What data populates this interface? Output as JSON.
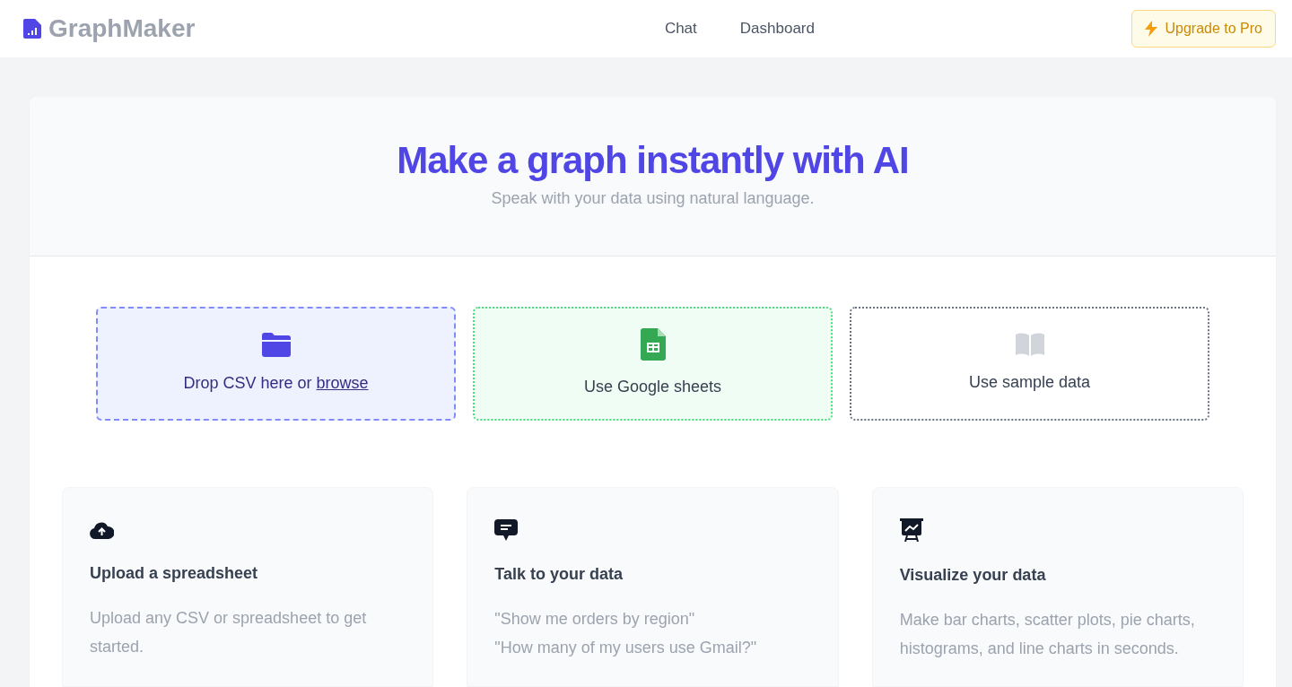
{
  "brand": {
    "name": "GraphMaker"
  },
  "nav": [
    {
      "label": "Chat"
    },
    {
      "label": "Dashboard"
    }
  ],
  "upgrade_button": {
    "label": "Upgrade to Pro"
  },
  "hero": {
    "title": "Make a graph instantly with AI",
    "subtitle": "Speak with your data using natural language."
  },
  "sources": [
    {
      "kind": "upload",
      "text": "Drop CSV here or",
      "link": "browse"
    },
    {
      "kind": "sheets",
      "text": "Use Google sheets"
    },
    {
      "kind": "sample",
      "text": "Use sample data"
    }
  ],
  "features": [
    {
      "kind": "upload",
      "title": "Upload a spreadsheet",
      "lines": [
        "Upload any CSV or spreadsheet to get started."
      ]
    },
    {
      "kind": "chat",
      "title": "Talk to your data",
      "lines": [
        "\"Show me orders by region\"",
        "\"How many of my users use Gmail?\""
      ]
    },
    {
      "kind": "chart",
      "title": "Visualize your data",
      "lines": [
        "Make bar charts, scatter plots, pie charts, histograms, and line charts in seconds."
      ]
    }
  ]
}
